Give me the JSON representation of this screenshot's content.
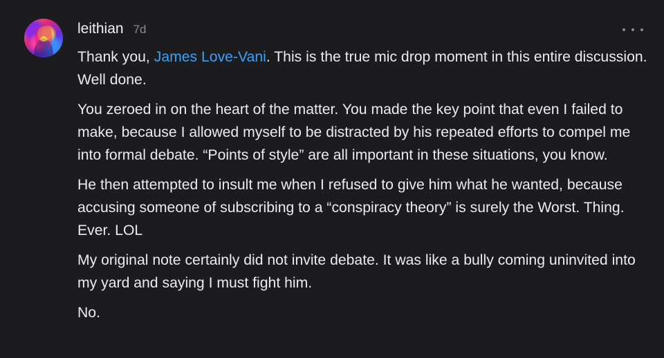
{
  "comment": {
    "username": "leithian",
    "timestamp": "7d",
    "more_icon": "ellipsis-icon",
    "colors": {
      "background": "#1c1c1e",
      "text": "#ececee",
      "muted": "#8b8b90",
      "mention": "#3ea0f5"
    },
    "paragraphs": [
      {
        "prefix": "Thank you, ",
        "mention": "James Love-Vani",
        "suffix": ". This is the true mic drop moment in this entire discussion. Well done."
      },
      {
        "text": "You zeroed in on the heart of the matter. You made the key point that even I failed to make, because I allowed myself to be distracted by his repeated efforts to compel me into formal debate. “Points of style” are all important in these situations, you know."
      },
      {
        "text": "He then attempted to insult me when I refused to give him what he wanted, because accusing someone of subscribing to a “conspiracy theory” is surely the Worst. Thing. Ever. LOL"
      },
      {
        "text": "My original note certainly did not invite debate. It was like a bully coming uninvited into my yard and saying I must fight him."
      },
      {
        "text": "No."
      }
    ]
  }
}
